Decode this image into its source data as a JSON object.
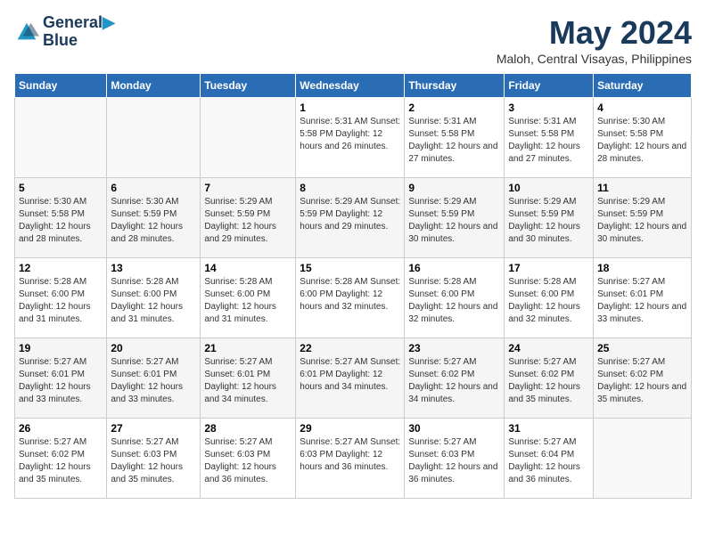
{
  "header": {
    "logo_line1": "General",
    "logo_line2": "Blue",
    "month_title": "May 2024",
    "location": "Maloh, Central Visayas, Philippines"
  },
  "days_of_week": [
    "Sunday",
    "Monday",
    "Tuesday",
    "Wednesday",
    "Thursday",
    "Friday",
    "Saturday"
  ],
  "weeks": [
    [
      {
        "day": "",
        "info": ""
      },
      {
        "day": "",
        "info": ""
      },
      {
        "day": "",
        "info": ""
      },
      {
        "day": "1",
        "info": "Sunrise: 5:31 AM\nSunset: 5:58 PM\nDaylight: 12 hours\nand 26 minutes."
      },
      {
        "day": "2",
        "info": "Sunrise: 5:31 AM\nSunset: 5:58 PM\nDaylight: 12 hours\nand 27 minutes."
      },
      {
        "day": "3",
        "info": "Sunrise: 5:31 AM\nSunset: 5:58 PM\nDaylight: 12 hours\nand 27 minutes."
      },
      {
        "day": "4",
        "info": "Sunrise: 5:30 AM\nSunset: 5:58 PM\nDaylight: 12 hours\nand 28 minutes."
      }
    ],
    [
      {
        "day": "5",
        "info": "Sunrise: 5:30 AM\nSunset: 5:58 PM\nDaylight: 12 hours\nand 28 minutes."
      },
      {
        "day": "6",
        "info": "Sunrise: 5:30 AM\nSunset: 5:59 PM\nDaylight: 12 hours\nand 28 minutes."
      },
      {
        "day": "7",
        "info": "Sunrise: 5:29 AM\nSunset: 5:59 PM\nDaylight: 12 hours\nand 29 minutes."
      },
      {
        "day": "8",
        "info": "Sunrise: 5:29 AM\nSunset: 5:59 PM\nDaylight: 12 hours\nand 29 minutes."
      },
      {
        "day": "9",
        "info": "Sunrise: 5:29 AM\nSunset: 5:59 PM\nDaylight: 12 hours\nand 30 minutes."
      },
      {
        "day": "10",
        "info": "Sunrise: 5:29 AM\nSunset: 5:59 PM\nDaylight: 12 hours\nand 30 minutes."
      },
      {
        "day": "11",
        "info": "Sunrise: 5:29 AM\nSunset: 5:59 PM\nDaylight: 12 hours\nand 30 minutes."
      }
    ],
    [
      {
        "day": "12",
        "info": "Sunrise: 5:28 AM\nSunset: 6:00 PM\nDaylight: 12 hours\nand 31 minutes."
      },
      {
        "day": "13",
        "info": "Sunrise: 5:28 AM\nSunset: 6:00 PM\nDaylight: 12 hours\nand 31 minutes."
      },
      {
        "day": "14",
        "info": "Sunrise: 5:28 AM\nSunset: 6:00 PM\nDaylight: 12 hours\nand 31 minutes."
      },
      {
        "day": "15",
        "info": "Sunrise: 5:28 AM\nSunset: 6:00 PM\nDaylight: 12 hours\nand 32 minutes."
      },
      {
        "day": "16",
        "info": "Sunrise: 5:28 AM\nSunset: 6:00 PM\nDaylight: 12 hours\nand 32 minutes."
      },
      {
        "day": "17",
        "info": "Sunrise: 5:28 AM\nSunset: 6:00 PM\nDaylight: 12 hours\nand 32 minutes."
      },
      {
        "day": "18",
        "info": "Sunrise: 5:27 AM\nSunset: 6:01 PM\nDaylight: 12 hours\nand 33 minutes."
      }
    ],
    [
      {
        "day": "19",
        "info": "Sunrise: 5:27 AM\nSunset: 6:01 PM\nDaylight: 12 hours\nand 33 minutes."
      },
      {
        "day": "20",
        "info": "Sunrise: 5:27 AM\nSunset: 6:01 PM\nDaylight: 12 hours\nand 33 minutes."
      },
      {
        "day": "21",
        "info": "Sunrise: 5:27 AM\nSunset: 6:01 PM\nDaylight: 12 hours\nand 34 minutes."
      },
      {
        "day": "22",
        "info": "Sunrise: 5:27 AM\nSunset: 6:01 PM\nDaylight: 12 hours\nand 34 minutes."
      },
      {
        "day": "23",
        "info": "Sunrise: 5:27 AM\nSunset: 6:02 PM\nDaylight: 12 hours\nand 34 minutes."
      },
      {
        "day": "24",
        "info": "Sunrise: 5:27 AM\nSunset: 6:02 PM\nDaylight: 12 hours\nand 35 minutes."
      },
      {
        "day": "25",
        "info": "Sunrise: 5:27 AM\nSunset: 6:02 PM\nDaylight: 12 hours\nand 35 minutes."
      }
    ],
    [
      {
        "day": "26",
        "info": "Sunrise: 5:27 AM\nSunset: 6:02 PM\nDaylight: 12 hours\nand 35 minutes."
      },
      {
        "day": "27",
        "info": "Sunrise: 5:27 AM\nSunset: 6:03 PM\nDaylight: 12 hours\nand 35 minutes."
      },
      {
        "day": "28",
        "info": "Sunrise: 5:27 AM\nSunset: 6:03 PM\nDaylight: 12 hours\nand 36 minutes."
      },
      {
        "day": "29",
        "info": "Sunrise: 5:27 AM\nSunset: 6:03 PM\nDaylight: 12 hours\nand 36 minutes."
      },
      {
        "day": "30",
        "info": "Sunrise: 5:27 AM\nSunset: 6:03 PM\nDaylight: 12 hours\nand 36 minutes."
      },
      {
        "day": "31",
        "info": "Sunrise: 5:27 AM\nSunset: 6:04 PM\nDaylight: 12 hours\nand 36 minutes."
      },
      {
        "day": "",
        "info": ""
      }
    ]
  ]
}
